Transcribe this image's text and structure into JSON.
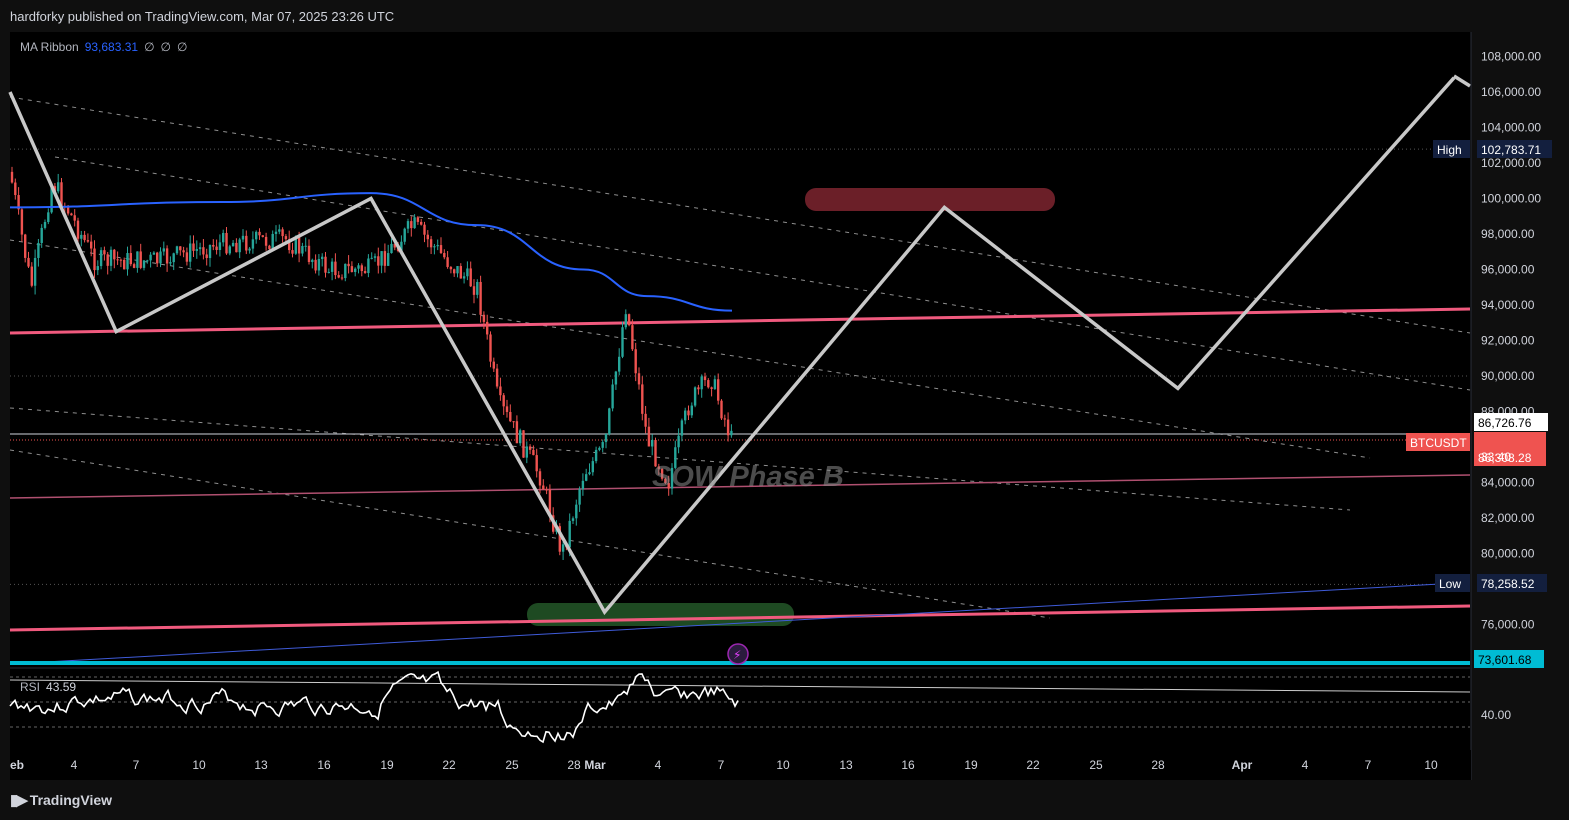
{
  "header": {
    "published_text": "hardforky published on TradingView.com, Mar 07, 2025 23:26 UTC"
  },
  "legend": {
    "ma_name": "MA Ribbon",
    "ma_value": "93,683.31",
    "ma_extras": [
      "∅",
      "∅",
      "∅"
    ],
    "rsi_name": "RSI",
    "rsi_value": "43.59"
  },
  "footer": {
    "brand": "TradingView",
    "icon": "tradingview-logo-icon"
  },
  "price_axis": {
    "ticks": [
      "108,000.00",
      "106,000.00",
      "104,000.00",
      "102,000.00",
      "100,000.00",
      "98,000.00",
      "96,000.00",
      "94,000.00",
      "92,000.00",
      "90,000.00",
      "88,000.00",
      "84,000.00",
      "82,000.00",
      "80,000.00",
      "76,000.00"
    ],
    "high_label": "High",
    "high_value": "102,783.71",
    "low_label": "Low",
    "low_value": "78,258.52",
    "crosshair_value": "86,726.76",
    "symbol_label": "BTCUSDT",
    "last_price": "86,308.28",
    "countdown": "33:40",
    "support_value": "73,601.68",
    "rsi_tick": "40.00"
  },
  "time_axis": {
    "ticks": [
      "eb",
      "4",
      "7",
      "10",
      "13",
      "16",
      "19",
      "22",
      "25",
      "28",
      "Mar",
      "4",
      "7",
      "10",
      "13",
      "16",
      "19",
      "22",
      "25",
      "28",
      "Apr",
      "4",
      "7",
      "10"
    ]
  },
  "annotation": {
    "text": "SOW Phase B"
  },
  "colors": {
    "background": "#000000",
    "up_candle": "#26a69a",
    "down_candle": "#ef5350",
    "ma_line": "#2962ff",
    "pink_line": "#f05a7e",
    "projection": "#c8c8c8",
    "resistance_zone": "#6b1f28",
    "support_zone": "#1e4a22",
    "support_line": "#00bcd4"
  },
  "chart_data": {
    "type": "candlestick",
    "symbol": "BTCUSDT",
    "y_range": [
      73000,
      109000
    ],
    "x_range": [
      "2025-02-02",
      "2025-04-11"
    ],
    "ohlc_points": [
      {
        "date": "2025-02-02",
        "close": 101500
      },
      {
        "date": "2025-02-03",
        "close": 95000
      },
      {
        "date": "2025-02-04",
        "close": 101000
      },
      {
        "date": "2025-02-06",
        "close": 96500
      },
      {
        "date": "2025-02-09",
        "close": 96500
      },
      {
        "date": "2025-02-12",
        "close": 97500
      },
      {
        "date": "2025-02-15",
        "close": 97700
      },
      {
        "date": "2025-02-17",
        "close": 96000
      },
      {
        "date": "2025-02-19",
        "close": 96000
      },
      {
        "date": "2025-02-21",
        "close": 98500
      },
      {
        "date": "2025-02-23",
        "close": 96000
      },
      {
        "date": "2025-02-24",
        "close": 95000
      },
      {
        "date": "2025-02-25",
        "close": 88500
      },
      {
        "date": "2025-02-27",
        "close": 84300
      },
      {
        "date": "2025-02-28",
        "close": 80000
      },
      {
        "date": "2025-03-01",
        "close": 84500
      },
      {
        "date": "2025-03-02",
        "close": 86000
      },
      {
        "date": "2025-03-03",
        "close": 94000
      },
      {
        "date": "2025-03-04",
        "close": 86500
      },
      {
        "date": "2025-03-05",
        "close": 84000
      },
      {
        "date": "2025-03-06",
        "close": 88500
      },
      {
        "date": "2025-03-07",
        "close": 90000
      },
      {
        "date": "2025-03-08",
        "close": 86308.28
      }
    ],
    "ma_line": [
      {
        "date": "2025-02-02",
        "value": 99500
      },
      {
        "date": "2025-02-12",
        "value": 99800
      },
      {
        "date": "2025-02-19",
        "value": 100300
      },
      {
        "date": "2025-02-24",
        "value": 98500
      },
      {
        "date": "2025-03-01",
        "value": 96000
      },
      {
        "date": "2025-03-04",
        "value": 94500
      },
      {
        "date": "2025-03-08",
        "value": 93683.31
      }
    ],
    "projection_path": [
      {
        "date": "2025-02-02",
        "value": 106000
      },
      {
        "date": "2025-02-07",
        "value": 92500
      },
      {
        "date": "2025-02-19",
        "value": 100000
      },
      {
        "date": "2025-03-02",
        "value": 76700
      },
      {
        "date": "2025-03-18",
        "value": 99500
      },
      {
        "date": "2025-03-29",
        "value": 89300
      },
      {
        "date": "2025-04-11",
        "value": 106800
      }
    ],
    "levels": {
      "high": 102783.71,
      "low": 78258.52,
      "current": 86308.28,
      "crosshair": 86726.76,
      "support": 73601.68
    },
    "rsi": {
      "value": 43.59,
      "tick": 40.0
    }
  }
}
